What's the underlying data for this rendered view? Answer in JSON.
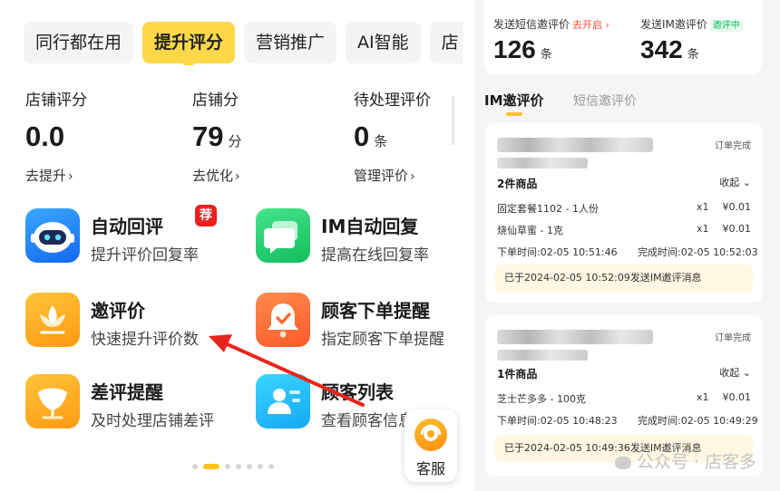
{
  "tabs": [
    "同行都在用",
    "提升评分",
    "营销推广",
    "AI智能",
    "店"
  ],
  "stats": [
    {
      "label": "店铺评分",
      "value": "0.0",
      "unit": "",
      "link": "去提升"
    },
    {
      "label": "店铺分",
      "value": "79",
      "unit": "分",
      "link": "去优化"
    },
    {
      "label": "待处理评价",
      "value": "0",
      "unit": "条",
      "link": "管理评价"
    }
  ],
  "features": [
    {
      "title": "自动回评",
      "desc": "提升评价回复率",
      "icon": "robot-icon",
      "badge": "荐"
    },
    {
      "title": "IM自动回复",
      "desc": "提高在线回复率",
      "icon": "chat-bubble-icon"
    },
    {
      "title": "邀评价",
      "desc": "快速提升评价数",
      "icon": "flower-icon"
    },
    {
      "title": "顾客下单提醒",
      "desc": "指定顾客下单提醒",
      "icon": "bell-icon"
    },
    {
      "title": "差评提醒",
      "desc": "及时处理店铺差评",
      "icon": "flower-shield-icon"
    },
    {
      "title": "顾客列表",
      "desc": "查看顾客信息",
      "icon": "customer-list-icon"
    }
  ],
  "carousel": {
    "count": 7,
    "active_index": 1
  },
  "kefu_label": "客服",
  "chevron": "›",
  "top_stats": [
    {
      "label": "发送短信邀评价",
      "status": "去开启",
      "status_color": "#ff4a3a",
      "value": "126",
      "unit": "条"
    },
    {
      "label": "发送IM邀评价",
      "status": "邀评中",
      "status_color": "#0bbd62",
      "value": "342",
      "unit": "条"
    }
  ],
  "right_tabs": {
    "active": "IM邀评价",
    "inactive": "短信邀评价"
  },
  "orders": [
    {
      "status": "订单完成",
      "count_label": "2件商品",
      "fold_label": "收起",
      "items": [
        {
          "name": "固定套餐1102 - 1人份",
          "qty": "x1",
          "price": "¥0.01"
        },
        {
          "name": "烧仙草蜜 - 1克",
          "qty": "x1",
          "price": "¥0.01"
        }
      ],
      "order_time": "下单时间:02-05 10:51:46",
      "finish_time": "完成时间:02-05 10:52:03",
      "note": "已于2024-02-05 10:52:09发送IM邀评消息"
    },
    {
      "status": "订单完成",
      "count_label": "1件商品",
      "fold_label": "收起",
      "items": [
        {
          "name": "芝士芒多多 - 100克",
          "qty": "x1",
          "price": "¥0.01"
        }
      ],
      "order_time": "下单时间:02-05 10:48:23",
      "finish_time": "完成时间:02-05 10:49:29",
      "note": "已于2024-02-05 10:49:36发送IM邀评消息"
    }
  ],
  "watermark": "公众号 · 店客多",
  "colors": {
    "accent": "#ffd84a",
    "arrow": "#e8251c"
  }
}
